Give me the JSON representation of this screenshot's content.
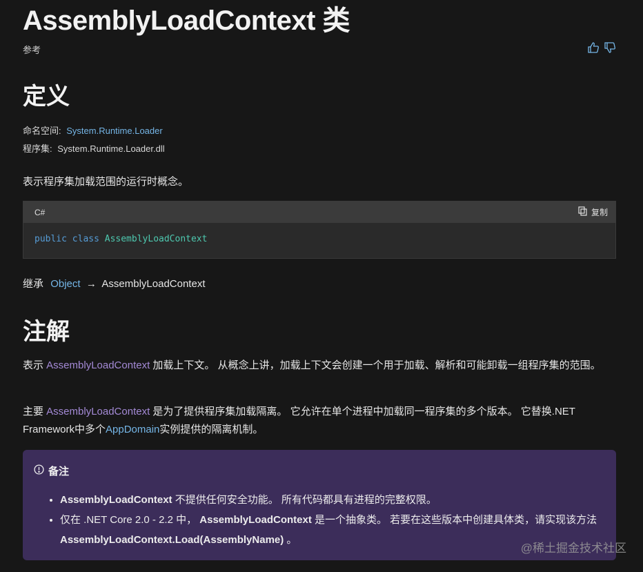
{
  "title": "AssemblyLoadContext 类",
  "ref_label": "参考",
  "feedback": {
    "like_icon": "thumbs-up-icon",
    "dislike_icon": "thumbs-down-icon"
  },
  "definition": {
    "heading": "定义",
    "namespace_label": "命名空间:",
    "namespace_value": "System.Runtime.Loader",
    "assembly_label": "程序集:",
    "assembly_value": "System.Runtime.Loader.dll",
    "summary": "表示程序集加载范围的运行时概念。"
  },
  "code": {
    "language": "C#",
    "copy_label": "复制",
    "keyword": "public class ",
    "class_name": "AssemblyLoadContext"
  },
  "inheritance": {
    "label": "继承",
    "base": "Object",
    "arrow": " → ",
    "derived": "AssemblyLoadContext"
  },
  "remarks": {
    "heading": "注解",
    "p1_pre": "表示 ",
    "p1_link": "AssemblyLoadContext",
    "p1_post": " 加载上下文。 从概念上讲，加载上下文会创建一个用于加载、解析和可能卸载一组程序集的范围。",
    "p2_pre": "主要 ",
    "p2_link": "AssemblyLoadContext",
    "p2_mid": " 是为了提供程序集加载隔离。 它允许在单个进程中加载同一程序集的多个版本。 它替换.NET Framework中多个",
    "p2_link2": "AppDomain",
    "p2_post": "实例提供的隔离机制。"
  },
  "note": {
    "heading": "备注",
    "item1_bold": "AssemblyLoadContext",
    "item1_text": " 不提供任何安全功能。 所有代码都具有进程的完整权限。",
    "item2_pre": "仅在 .NET Core 2.0 - 2.2 中， ",
    "item2_bold": "AssemblyLoadContext",
    "item2_mid": " 是一个抽象类。 若要在这些版本中创建具体类，请实现该方法 ",
    "item2_bold2": "AssemblyLoadContext.Load(AssemblyName)",
    "item2_post": " 。"
  },
  "watermark": "@稀土掘金技术社区"
}
